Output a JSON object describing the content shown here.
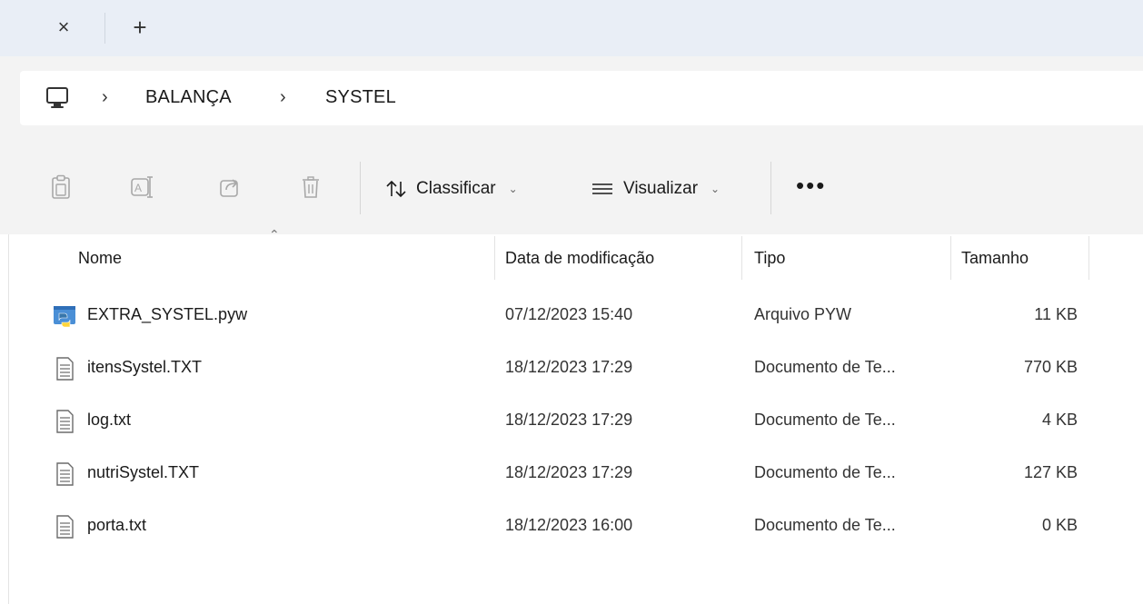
{
  "tabbar": {
    "close_glyph": "×",
    "new_tab_glyph": "+"
  },
  "breadcrumb": {
    "sep": "›",
    "items": [
      "BALANÇA",
      "SYSTEL"
    ]
  },
  "toolbar": {
    "sort_label": "Classificar",
    "view_label": "Visualizar",
    "more_label": "•••"
  },
  "columns": {
    "name": "Nome",
    "date": "Data de modificação",
    "type": "Tipo",
    "size": "Tamanho"
  },
  "files": [
    {
      "name": "EXTRA_SYSTEL.pyw",
      "date": "07/12/2023 15:40",
      "type": "Arquivo PYW",
      "size": "11 KB",
      "icon": "python-file-icon"
    },
    {
      "name": "itensSystel.TXT",
      "date": "18/12/2023 17:29",
      "type": "Documento de Te...",
      "size": "770 KB",
      "icon": "text-file-icon"
    },
    {
      "name": "log.txt",
      "date": "18/12/2023 17:29",
      "type": "Documento de Te...",
      "size": "4 KB",
      "icon": "text-file-icon"
    },
    {
      "name": "nutriSystel.TXT",
      "date": "18/12/2023 17:29",
      "type": "Documento de Te...",
      "size": "127 KB",
      "icon": "text-file-icon"
    },
    {
      "name": "porta.txt",
      "date": "18/12/2023 16:00",
      "type": "Documento de Te...",
      "size": "0 KB",
      "icon": "text-file-icon"
    }
  ],
  "colors": {
    "tabbar_bg": "#e9eef6",
    "chrome_bg": "#f3f3f3",
    "content_bg": "#ffffff",
    "python_blue": "#3776ab",
    "python_yellow": "#ffd43b"
  }
}
